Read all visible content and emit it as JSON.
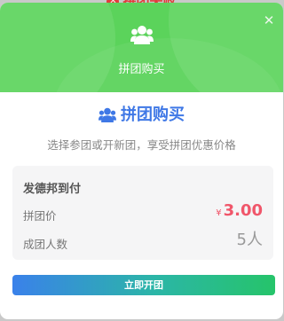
{
  "backdrop": {
    "status_text": "拼团失败"
  },
  "modal": {
    "header": {
      "icon": "users-icon",
      "title": "拼团购买",
      "close_icon": "close-icon"
    },
    "title": "拼团购买",
    "title_icon": "users-icon",
    "subtitle": "选择参团或开新团，享受拼团优惠价格",
    "card": {
      "product_name": "发德邦到付",
      "price_label": "拼团价",
      "price_currency": "¥",
      "price_value": "3.00",
      "group_size_label": "成团人数",
      "group_size_value": "5人"
    },
    "action_button": "立即开团"
  },
  "colors": {
    "header_green": "#5bd35b",
    "title_blue": "#3f78e6",
    "price_red": "#f0566a",
    "button_gradient": [
      "#3a81ea",
      "#26c46a"
    ]
  }
}
